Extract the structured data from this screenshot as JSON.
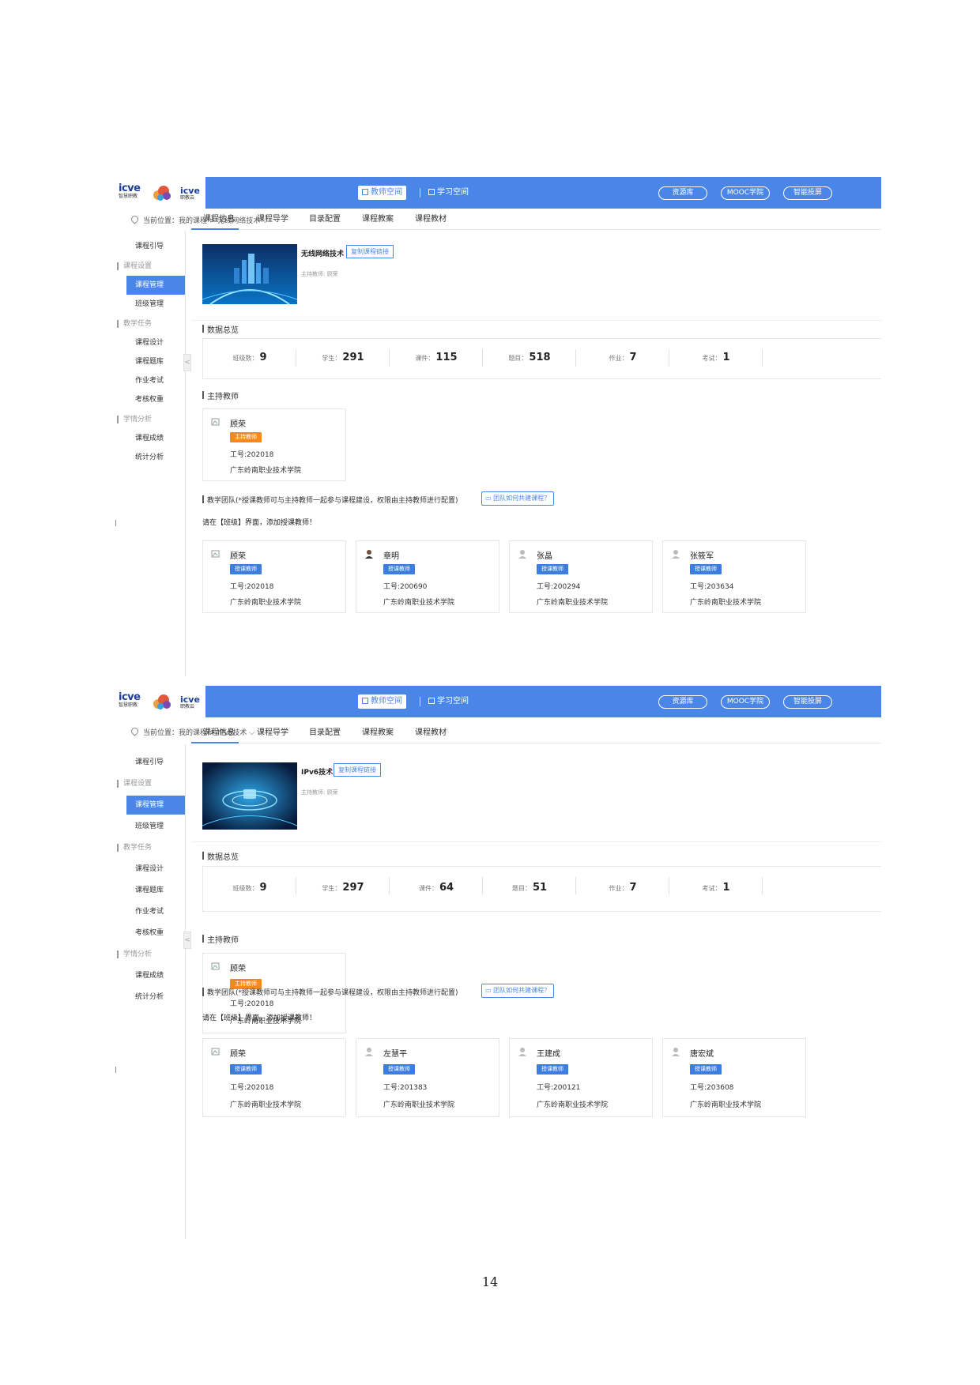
{
  "colors": {
    "accent": "#4a86e8",
    "host_badge": "#f5891f",
    "lecturer_badge": "#3b7de0"
  },
  "header": {
    "logo_left": "icve",
    "logo_left_sub": "智慧职教",
    "logo_right": "icve",
    "logo_right_sub": "职教云",
    "tab_teacher": "教师空间",
    "tab_study": "学习空间",
    "btn_resource": "资源库",
    "btn_mooc": "MOOC学院",
    "btn_projector": "智能投屏"
  },
  "sidebar": {
    "items": [
      {
        "label": "课程引导",
        "kind": "item"
      },
      {
        "label": "课程设置",
        "kind": "group"
      },
      {
        "label": "课程管理",
        "kind": "item",
        "active": true
      },
      {
        "label": "班级管理",
        "kind": "item"
      },
      {
        "label": "教学任务",
        "kind": "group"
      },
      {
        "label": "课程设计",
        "kind": "item"
      },
      {
        "label": "课程题库",
        "kind": "item"
      },
      {
        "label": "作业考试",
        "kind": "item"
      },
      {
        "label": "考核权重",
        "kind": "item"
      },
      {
        "label": "学情分析",
        "kind": "group"
      },
      {
        "label": "课程成绩",
        "kind": "item"
      },
      {
        "label": "统计分析",
        "kind": "item"
      }
    ],
    "collapse_glyph": "<"
  },
  "tabs": [
    "课程信息",
    "课程导学",
    "目录配置",
    "课程教案",
    "课程教材"
  ],
  "labels": {
    "copy_link": "复制课程链接",
    "host_prefix": "主持教师:",
    "data_overview": "数据总览",
    "host_teacher": "主持教师",
    "team_title": "教学团队(*授课教师可与主持教师一起参与课程建设，权限由主持教师进行配置)",
    "team_help": "团队如何共建课程？",
    "team_note": "请在【班级】界面，添加授课教师！",
    "badge_host": "主持教师",
    "badge_lecturer": "授课教师",
    "id_prefix": "工号:",
    "stat_classes": "班级数：",
    "stat_students": "学生：",
    "stat_courseware": "课件：",
    "stat_questions": "题目：",
    "stat_homework": "作业：",
    "stat_exams": "考试："
  },
  "screens": [
    {
      "breadcrumb": "当前位置：我的课程 > 无线网络技术 ⌵",
      "course_name": "无线网络技术",
      "host_name": "顾荣",
      "stats": {
        "classes": "9",
        "students": "291",
        "courseware": "115",
        "questions": "518",
        "homework": "7",
        "exams": "1"
      },
      "host": {
        "name": "顾荣",
        "id": "202018",
        "school": "广东岭南职业技术学院"
      },
      "team": [
        {
          "name": "顾荣",
          "id": "202018",
          "school": "广东岭南职业技术学院",
          "avatar": "broken-image-icon"
        },
        {
          "name": "章明",
          "id": "200690",
          "school": "广东岭南职业技术学院",
          "avatar": "person-photo-icon"
        },
        {
          "name": "张晶",
          "id": "200294",
          "school": "广东岭南职业技术学院",
          "avatar": "user-silhouette-icon"
        },
        {
          "name": "张筱军",
          "id": "203634",
          "school": "广东岭南职业技术学院",
          "avatar": "user-silhouette-icon"
        }
      ]
    },
    {
      "breadcrumb": "当前位置：我的课程 > IPv6技术 ⌵",
      "course_name": "IPv6技术",
      "host_name": "顾荣",
      "stats": {
        "classes": "9",
        "students": "297",
        "courseware": "64",
        "questions": "51",
        "homework": "7",
        "exams": "1"
      },
      "host": {
        "name": "顾荣",
        "id": "202018",
        "school": "广东岭南职业技术学院"
      },
      "team": [
        {
          "name": "顾荣",
          "id": "202018",
          "school": "广东岭南职业技术学院",
          "avatar": "broken-image-icon"
        },
        {
          "name": "左慧平",
          "id": "201383",
          "school": "广东岭南职业技术学院",
          "avatar": "user-silhouette-icon"
        },
        {
          "name": "王建成",
          "id": "200121",
          "school": "广东岭南职业技术学院",
          "avatar": "user-silhouette-icon"
        },
        {
          "name": "唐宏斌",
          "id": "203608",
          "school": "广东岭南职业技术学院",
          "avatar": "user-silhouette-icon"
        }
      ]
    }
  ],
  "page_number": "14"
}
